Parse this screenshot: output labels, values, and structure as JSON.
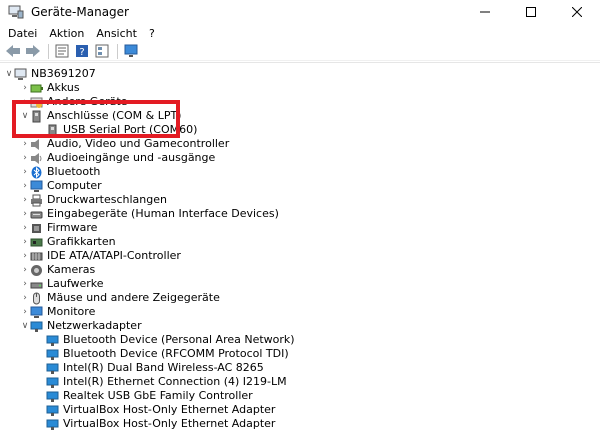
{
  "window": {
    "title": "Geräte-Manager"
  },
  "menu": [
    "Datei",
    "Aktion",
    "Ansicht",
    "?"
  ],
  "tree": {
    "root": "NB3691207",
    "categories": [
      {
        "label": "Akkus",
        "icon": "battery-icon",
        "expanded": false
      },
      {
        "label": "Andere Geräte",
        "icon": "unknown-device-icon",
        "expanded": false
      },
      {
        "label": "Anschlüsse (COM & LPT)",
        "icon": "port-icon",
        "expanded": true,
        "children": [
          "USB Serial Port (COM60)"
        ]
      },
      {
        "label": "Audio, Video und Gamecontroller",
        "icon": "audio-icon",
        "expanded": false
      },
      {
        "label": "Audioeingänge und -ausgänge",
        "icon": "speaker-icon",
        "expanded": false
      },
      {
        "label": "Bluetooth",
        "icon": "bluetooth-icon",
        "expanded": false
      },
      {
        "label": "Computer",
        "icon": "computer-icon",
        "expanded": false
      },
      {
        "label": "Druckwarteschlangen",
        "icon": "printer-icon",
        "expanded": false
      },
      {
        "label": "Eingabegeräte (Human Interface Devices)",
        "icon": "hid-icon",
        "expanded": false
      },
      {
        "label": "Firmware",
        "icon": "firmware-icon",
        "expanded": false
      },
      {
        "label": "Grafikkarten",
        "icon": "display-adapter-icon",
        "expanded": false
      },
      {
        "label": "IDE ATA/ATAPI-Controller",
        "icon": "ide-controller-icon",
        "expanded": false
      },
      {
        "label": "Kameras",
        "icon": "camera-icon",
        "expanded": false
      },
      {
        "label": "Laufwerke",
        "icon": "disk-drive-icon",
        "expanded": false
      },
      {
        "label": "Mäuse und andere Zeigegeräte",
        "icon": "mouse-icon",
        "expanded": false
      },
      {
        "label": "Monitore",
        "icon": "monitor-icon",
        "expanded": false
      },
      {
        "label": "Netzwerkadapter",
        "icon": "network-adapter-icon",
        "expanded": true,
        "children": [
          "Bluetooth Device (Personal Area Network)",
          "Bluetooth Device (RFCOMM Protocol TDI)",
          "Intel(R) Dual Band Wireless-AC 8265",
          "Intel(R) Ethernet Connection (4) I219-LM",
          "Realtek USB GbE Family Controller",
          "VirtualBox Host-Only Ethernet Adapter",
          "VirtualBox Host-Only Ethernet Adapter"
        ]
      }
    ]
  },
  "colors": {
    "highlight": "#e31b23",
    "bluetooth": "#1a6fd1",
    "network": "#2a8bd6"
  }
}
